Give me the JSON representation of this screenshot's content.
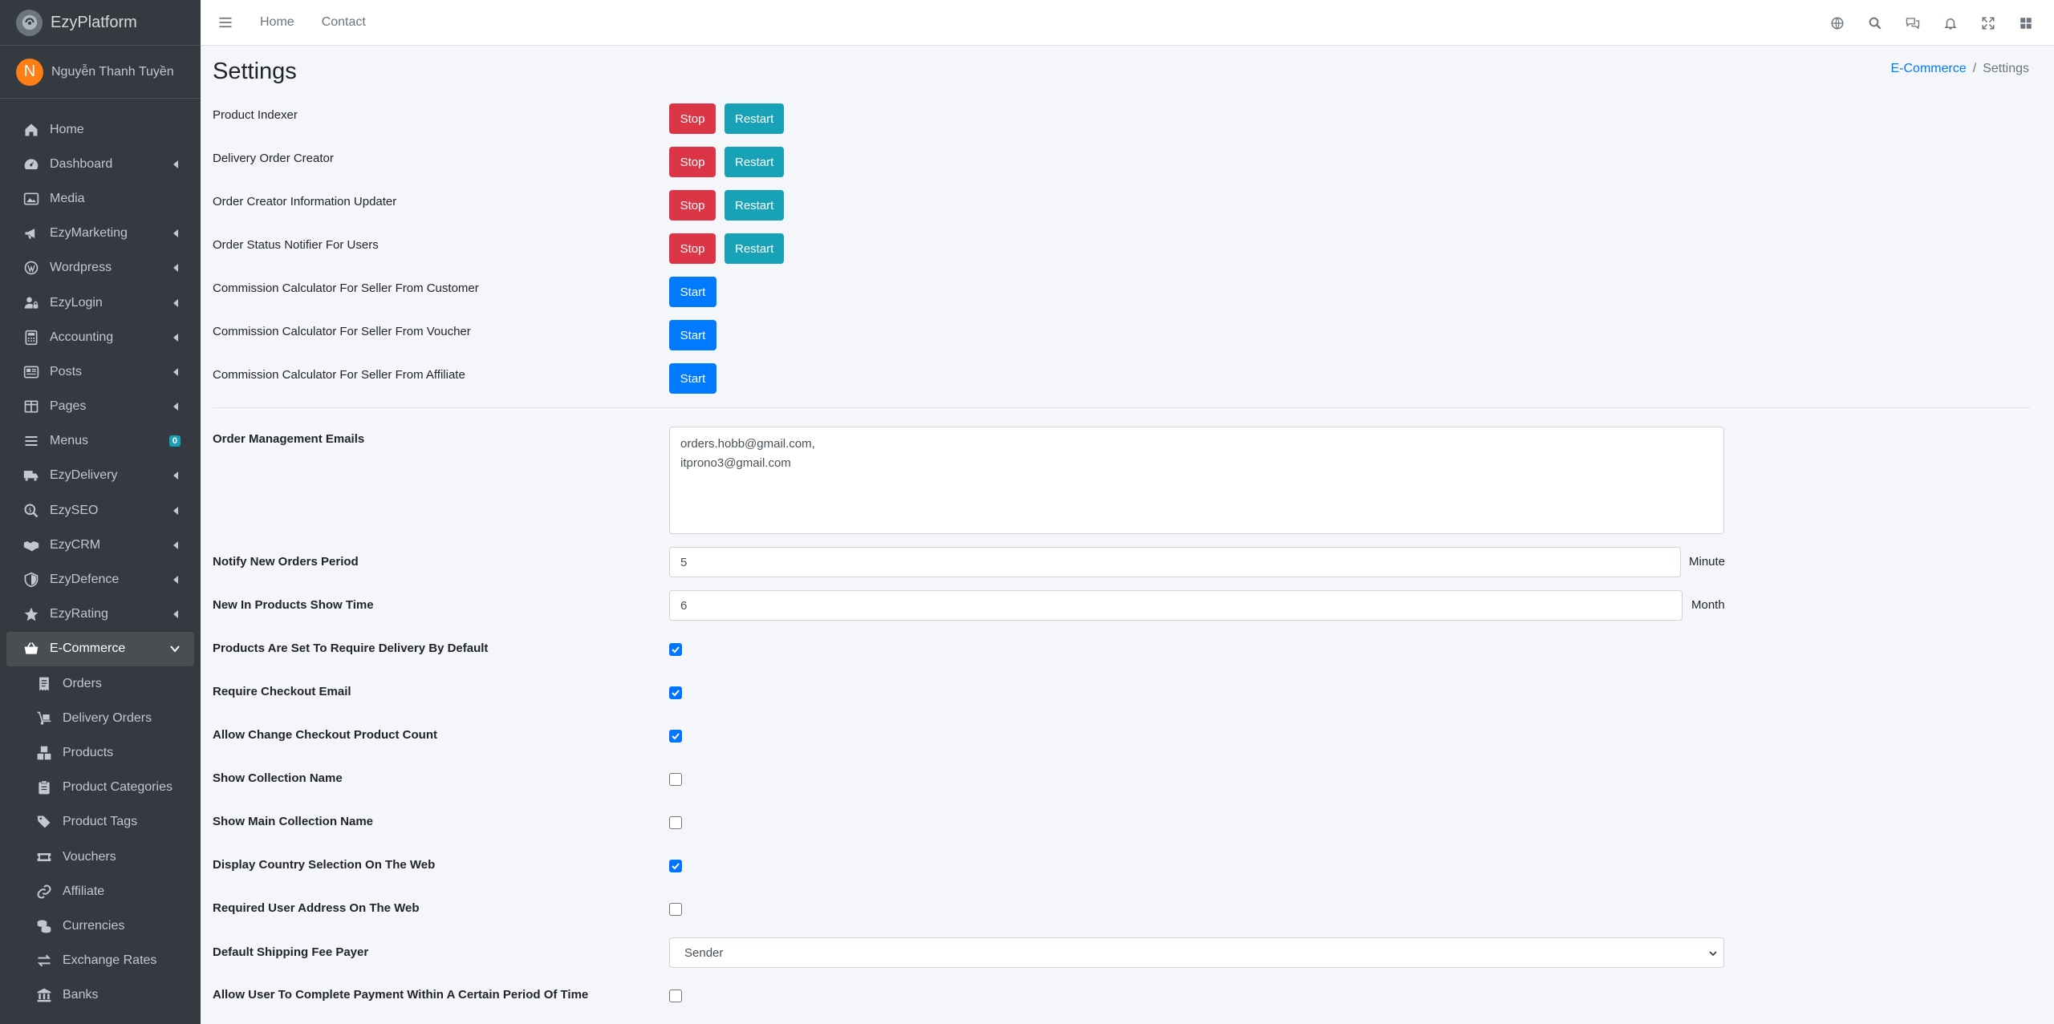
{
  "brand": {
    "name": "EzyPlatform"
  },
  "user": {
    "initial": "N",
    "name": "Nguyễn Thanh Tuyền"
  },
  "sidebar": {
    "items": [
      {
        "label": "Home",
        "icon": "home-icon"
      },
      {
        "label": "Dashboard",
        "icon": "dashboard-icon"
      },
      {
        "label": "Media",
        "icon": "image-icon"
      },
      {
        "label": "EzyMarketing",
        "icon": "megaphone-icon"
      },
      {
        "label": "Wordpress",
        "icon": "wordpress-icon"
      },
      {
        "label": "EzyLogin",
        "icon": "user-lock-icon"
      },
      {
        "label": "Accounting",
        "icon": "calculator-icon"
      },
      {
        "label": "Posts",
        "icon": "newspaper-icon"
      },
      {
        "label": "Pages",
        "icon": "columns-icon"
      },
      {
        "label": "Menus",
        "icon": "bars-icon",
        "badge": "0"
      },
      {
        "label": "EzyDelivery",
        "icon": "truck-icon"
      },
      {
        "label": "EzySEO",
        "icon": "search-dollar-icon"
      },
      {
        "label": "EzyCRM",
        "icon": "handshake-icon"
      },
      {
        "label": "EzyDefence",
        "icon": "shield-icon"
      },
      {
        "label": "EzyRating",
        "icon": "star-icon"
      },
      {
        "label": "E-Commerce",
        "icon": "basket-icon"
      }
    ],
    "sub_items": [
      {
        "label": "Orders",
        "icon": "receipt-icon"
      },
      {
        "label": "Delivery Orders",
        "icon": "dolly-icon"
      },
      {
        "label": "Products",
        "icon": "boxes-icon"
      },
      {
        "label": "Product Categories",
        "icon": "clipboard-icon"
      },
      {
        "label": "Product Tags",
        "icon": "tags-icon"
      },
      {
        "label": "Vouchers",
        "icon": "ticket-icon"
      },
      {
        "label": "Affiliate",
        "icon": "link-icon"
      },
      {
        "label": "Currencies",
        "icon": "coins-icon"
      },
      {
        "label": "Exchange Rates",
        "icon": "exchange-icon"
      },
      {
        "label": "Banks",
        "icon": "bank-icon"
      }
    ]
  },
  "topbar": {
    "links": [
      "Home",
      "Contact"
    ],
    "icons": [
      "globe-icon",
      "search-icon",
      "comments-icon",
      "bell-icon",
      "expand-icon",
      "apps-icon"
    ]
  },
  "page": {
    "title": "Settings",
    "breadcrumb": {
      "parent": "E-Commerce",
      "separator": "/",
      "current": "Settings"
    }
  },
  "workers": [
    {
      "label": "Product Indexer",
      "buttons": [
        "Stop",
        "Restart"
      ]
    },
    {
      "label": "Delivery Order Creator",
      "buttons": [
        "Stop",
        "Restart"
      ]
    },
    {
      "label": "Order Creator Information Updater",
      "buttons": [
        "Stop",
        "Restart"
      ]
    },
    {
      "label": "Order Status Notifier For Users",
      "buttons": [
        "Stop",
        "Restart"
      ]
    },
    {
      "label": "Commission Calculator For Seller From Customer",
      "buttons": [
        "Start"
      ]
    },
    {
      "label": "Commission Calculator For Seller From Voucher",
      "buttons": [
        "Start"
      ]
    },
    {
      "label": "Commission Calculator For Seller From Affiliate",
      "buttons": [
        "Start"
      ]
    }
  ],
  "settings": {
    "emails": {
      "label": "Order Management Emails",
      "value": "orders.hobb@gmail.com,\nitprono3@gmail.com"
    },
    "notify_period": {
      "label": "Notify New Orders Period",
      "value": "5",
      "unit": "Minute"
    },
    "new_in_time": {
      "label": "New In Products Show Time",
      "value": "6",
      "unit": "Month"
    },
    "checkboxes": [
      {
        "label": "Products Are Set To Require Delivery By Default",
        "checked": true
      },
      {
        "label": "Require Checkout Email",
        "checked": true
      },
      {
        "label": "Allow Change Checkout Product Count",
        "checked": true
      },
      {
        "label": "Show Collection Name",
        "checked": false
      },
      {
        "label": "Show Main Collection Name",
        "checked": false
      },
      {
        "label": "Display Country Selection On The Web",
        "checked": true
      },
      {
        "label": "Required User Address On The Web",
        "checked": false
      }
    ],
    "shipping_payer": {
      "label": "Default Shipping Fee Payer",
      "value": "Sender"
    },
    "payment_period": {
      "label": "Allow User To Complete Payment Within A Certain Period Of Time",
      "checked": false
    }
  },
  "colors": {
    "sidebar_bg": "#343a40",
    "stop": "#dc3545",
    "restart": "#17a2b8",
    "start": "#007bff",
    "checkbox": "#0075ff",
    "avatar": "#fd7e14"
  }
}
